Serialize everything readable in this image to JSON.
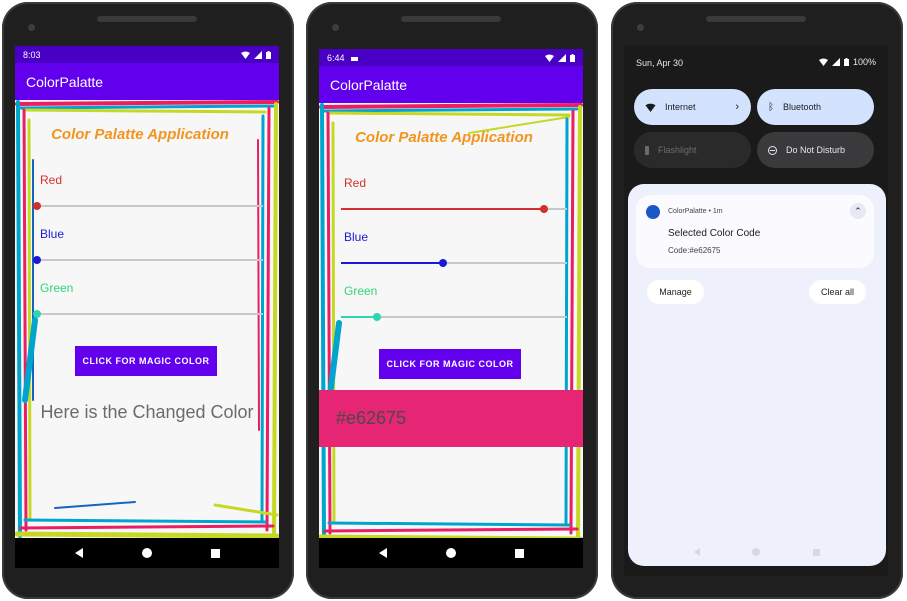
{
  "phone1": {
    "status_time": "8:03",
    "app_title": "ColorPalatte",
    "heading": "Color Palatte Application",
    "sliders": [
      {
        "label": "Red",
        "value": 0.0,
        "color": "#d32f2f"
      },
      {
        "label": "Blue",
        "value": 0.0,
        "color": "#1a1ad6"
      },
      {
        "label": "Green",
        "value": 0.0,
        "color": "#2ed57a"
      }
    ],
    "button_label": "CLICK FOR MAGIC COLOR",
    "result_text": "Here is the Changed Color"
  },
  "phone2": {
    "status_time": "6:44",
    "app_title": "ColorPalatte",
    "heading": "Color Palatte Application",
    "sliders": [
      {
        "label": "Red",
        "value": 0.9,
        "color": "#d32f2f"
      },
      {
        "label": "Blue",
        "value": 0.45,
        "color": "#1a1ad6"
      },
      {
        "label": "Green",
        "value": 0.16,
        "color": "#2ed5b0"
      }
    ],
    "button_label": "CLICK FOR MAGIC COLOR",
    "result_text": "#e62675",
    "result_color": "#e62675"
  },
  "phone3": {
    "date": "Sun, Apr 30",
    "battery": "100%",
    "tiles": {
      "internet": "Internet",
      "bluetooth": "Bluetooth",
      "flashlight": "Flashlight",
      "dnd": "Do Not Disturb"
    },
    "notification": {
      "app": "ColorPalatte",
      "time": "1m",
      "title": "Selected Color Code",
      "body": "Code:#e62675"
    },
    "manage_label": "Manage",
    "clear_label": "Clear all"
  }
}
